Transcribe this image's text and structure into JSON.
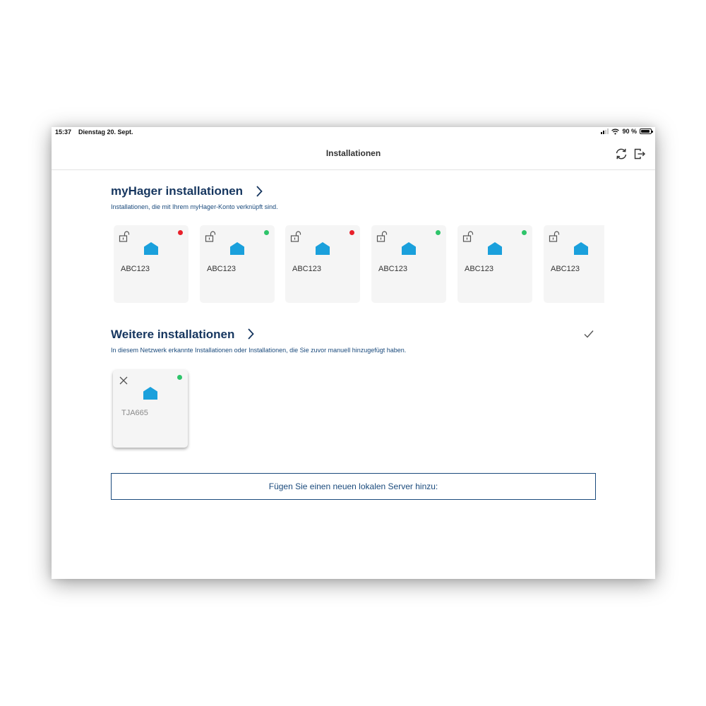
{
  "status_bar": {
    "time": "15:37",
    "date": "Dienstag 20. Sept.",
    "battery": "90 %"
  },
  "nav": {
    "title": "Installationen",
    "refresh_icon": "refresh-icon",
    "logout_icon": "logout-icon"
  },
  "myhager": {
    "title": "myHager installationen",
    "subtitle": "Installationen, die mit Ihrem myHager-Konto verknüpft sind.",
    "cards": [
      {
        "name": "ABC123",
        "status": "offline",
        "status_color": "#e8202a"
      },
      {
        "name": "ABC123",
        "status": "online",
        "status_color": "#2ec46a"
      },
      {
        "name": "ABC123",
        "status": "offline",
        "status_color": "#e8202a"
      },
      {
        "name": "ABC123",
        "status": "online",
        "status_color": "#2ec46a"
      },
      {
        "name": "ABC123",
        "status": "online",
        "status_color": "#2ec46a"
      },
      {
        "name": "ABC123",
        "status": "",
        "status_color": ""
      }
    ]
  },
  "weitere": {
    "title": "Weitere installationen",
    "subtitle": "In diesem Netzwerk erkannte Installationen oder Installationen, die Sie zuvor manuell hinzugefügt haben.",
    "cards": [
      {
        "name": "TJA665",
        "status": "online",
        "status_color": "#2ec46a"
      }
    ]
  },
  "add_button": {
    "label": "Fügen Sie einen neuen lokalen Server hinzu:"
  },
  "colors": {
    "accent": "#16365f",
    "link": "#1a4a7c",
    "house": "#1aa0dc",
    "card_bg": "#f5f5f5"
  }
}
